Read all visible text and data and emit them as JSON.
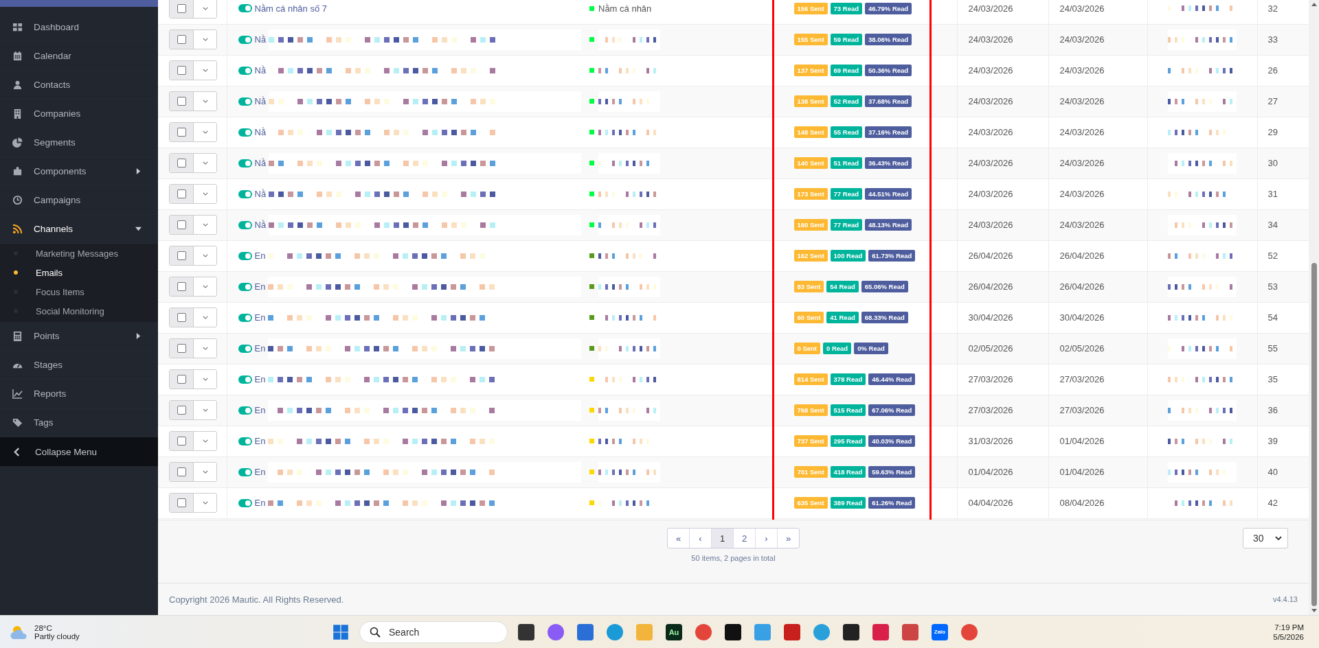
{
  "sidebar": {
    "items": [
      {
        "label": "Dashboard",
        "kind": "link"
      },
      {
        "label": "Calendar",
        "kind": "link"
      },
      {
        "label": "Contacts",
        "kind": "link"
      },
      {
        "label": "Companies",
        "kind": "link"
      },
      {
        "label": "Segments",
        "kind": "link"
      },
      {
        "label": "Components",
        "kind": "menu",
        "expanded": false
      },
      {
        "label": "Campaigns",
        "kind": "link"
      },
      {
        "label": "Channels",
        "kind": "menu",
        "expanded": true,
        "children": [
          {
            "label": "Marketing Messages",
            "selected": false
          },
          {
            "label": "Emails",
            "selected": true
          },
          {
            "label": "Focus Items",
            "selected": false
          },
          {
            "label": "Social Monitoring",
            "selected": false
          }
        ]
      },
      {
        "label": "Points",
        "kind": "menu",
        "expanded": false
      },
      {
        "label": "Stages",
        "kind": "link"
      },
      {
        "label": "Reports",
        "kind": "link"
      },
      {
        "label": "Tags",
        "kind": "link"
      }
    ],
    "collapse_label": "Collapse Menu"
  },
  "table": {
    "rows": [
      {
        "checked": false,
        "published": true,
        "name": "Nằm cá nhân số 7",
        "category": "Nằm cá nhân",
        "color": "#00ff44",
        "sent": "156 Sent",
        "read": "73 Read",
        "rate": "46.79% Read",
        "created": "24/03/2026",
        "modified": "24/03/2026",
        "id": "32"
      },
      {
        "checked": false,
        "published": true,
        "name": "Nằ",
        "color": "#00ff44",
        "sent": "155 Sent",
        "read": "59 Read",
        "rate": "38.06% Read",
        "created": "24/03/2026",
        "modified": "24/03/2026",
        "id": "33"
      },
      {
        "checked": false,
        "published": true,
        "name": "Nằ",
        "color": "#00ff44",
        "sent": "137 Sent",
        "read": "69 Read",
        "rate": "50.36% Read",
        "created": "24/03/2026",
        "modified": "24/03/2026",
        "id": "26"
      },
      {
        "checked": false,
        "published": true,
        "name": "Nằ",
        "color": "#00ff44",
        "sent": "138 Sent",
        "read": "52 Read",
        "rate": "37.68% Read",
        "created": "24/03/2026",
        "modified": "24/03/2026",
        "id": "27"
      },
      {
        "checked": false,
        "published": true,
        "name": "Nằ",
        "color": "#00ff44",
        "sent": "148 Sent",
        "read": "55 Read",
        "rate": "37.16% Read",
        "created": "24/03/2026",
        "modified": "24/03/2026",
        "id": "29"
      },
      {
        "checked": false,
        "published": true,
        "name": "Nằ",
        "color": "#00ff44",
        "sent": "140 Sent",
        "read": "51 Read",
        "rate": "36.43% Read",
        "created": "24/03/2026",
        "modified": "24/03/2026",
        "id": "30"
      },
      {
        "checked": false,
        "published": true,
        "name": "Nằ",
        "color": "#00ff44",
        "sent": "173 Sent",
        "read": "77 Read",
        "rate": "44.51% Read",
        "created": "24/03/2026",
        "modified": "24/03/2026",
        "id": "31"
      },
      {
        "checked": false,
        "published": true,
        "name": "Nằ",
        "color": "#00ff44",
        "sent": "160 Sent",
        "read": "77 Read",
        "rate": "48.13% Read",
        "created": "24/03/2026",
        "modified": "24/03/2026",
        "id": "34"
      },
      {
        "checked": false,
        "published": true,
        "name": "En",
        "color": "#5a9a1a",
        "sent": "162 Sent",
        "read": "100 Read",
        "rate": "61.73% Read",
        "created": "26/04/2026",
        "modified": "26/04/2026",
        "id": "52"
      },
      {
        "checked": false,
        "published": true,
        "name": "En",
        "color": "#5a9a1a",
        "sent": "83 Sent",
        "read": "54 Read",
        "rate": "65.06% Read",
        "created": "26/04/2026",
        "modified": "26/04/2026",
        "id": "53"
      },
      {
        "checked": false,
        "published": true,
        "name": "En",
        "color": "#5a9a1a",
        "sent": "60 Sent",
        "read": "41 Read",
        "rate": "68.33% Read",
        "created": "30/04/2026",
        "modified": "30/04/2026",
        "id": "54"
      },
      {
        "checked": false,
        "published": true,
        "name": "En",
        "color": "#5a9a1a",
        "sent": "0 Sent",
        "read": "0 Read",
        "rate": "0% Read",
        "created": "02/05/2026",
        "modified": "02/05/2026",
        "id": "55"
      },
      {
        "checked": false,
        "published": true,
        "name": "En",
        "color": "#ffd700",
        "sent": "814 Sent",
        "read": "378 Read",
        "rate": "46.44% Read",
        "created": "27/03/2026",
        "modified": "27/03/2026",
        "id": "35"
      },
      {
        "checked": false,
        "published": true,
        "name": "En",
        "color": "#ffd700",
        "sent": "768 Sent",
        "read": "515 Read",
        "rate": "67.06% Read",
        "created": "27/03/2026",
        "modified": "27/03/2026",
        "id": "36"
      },
      {
        "checked": false,
        "published": true,
        "name": "En",
        "color": "#ffd700",
        "sent": "737 Sent",
        "read": "295 Read",
        "rate": "40.03% Read",
        "created": "31/03/2026",
        "modified": "01/04/2026",
        "id": "39"
      },
      {
        "checked": false,
        "published": true,
        "name": "En",
        "color": "#ffd700",
        "sent": "701 Sent",
        "read": "418 Read",
        "rate": "59.63% Read",
        "created": "01/04/2026",
        "modified": "01/04/2026",
        "id": "40"
      },
      {
        "checked": false,
        "published": true,
        "name": "En",
        "color": "#ffd700",
        "sent": "635 Sent",
        "read": "389 Read",
        "rate": "61.26% Read",
        "created": "04/04/2026",
        "modified": "08/04/2026",
        "id": "42"
      }
    ]
  },
  "pagination": {
    "pages": [
      {
        "label": "«",
        "selected": false
      },
      {
        "label": "‹",
        "selected": false
      },
      {
        "label": "1",
        "selected": true
      },
      {
        "label": "2",
        "selected": false
      },
      {
        "label": "›",
        "selected": false
      },
      {
        "label": "»",
        "selected": false
      }
    ],
    "summary": "50 items, 2 pages in total",
    "per_page": "30"
  },
  "footer": {
    "copyright": "Copyright 2026 Mautic. All Rights Reserved.",
    "version": "v4.4.13"
  },
  "taskbar": {
    "temperature": "28°C",
    "weather": "Partly cloudy",
    "search_placeholder": "Search",
    "apps": [
      {
        "kind": "tasks"
      },
      {
        "kind": "copilot"
      },
      {
        "kind": "store"
      },
      {
        "kind": "edge"
      },
      {
        "kind": "folder"
      },
      {
        "kind": "audition",
        "label": "Au"
      },
      {
        "kind": "chrome"
      },
      {
        "kind": "capcut"
      },
      {
        "kind": "player"
      },
      {
        "kind": "filezilla"
      },
      {
        "kind": "telegram"
      },
      {
        "kind": "notes"
      },
      {
        "kind": "media"
      },
      {
        "kind": "pinned"
      },
      {
        "kind": "zalo",
        "label": "Zalo"
      },
      {
        "kind": "chrome"
      }
    ],
    "time": "7:19 PM",
    "date": "5/5/2026"
  }
}
